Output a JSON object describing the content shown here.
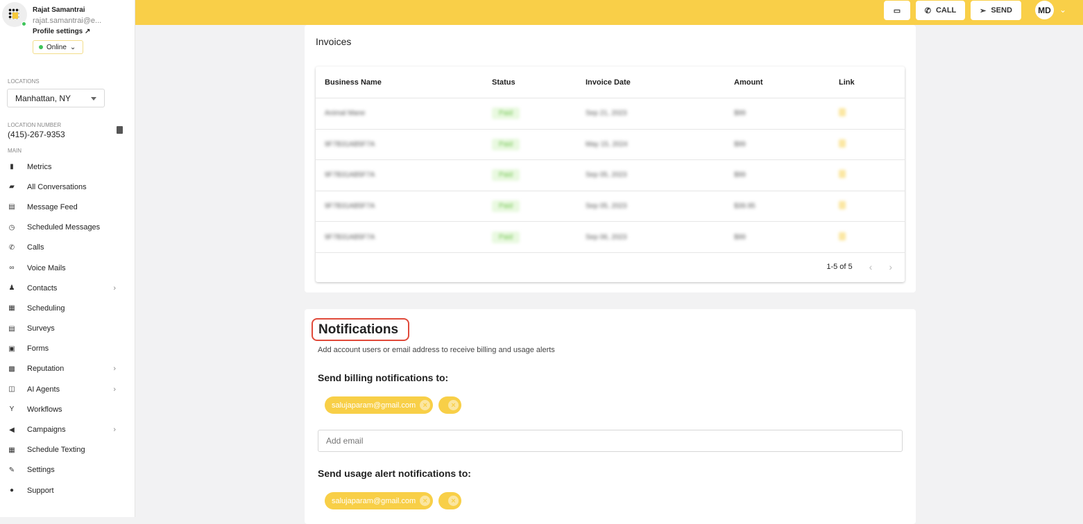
{
  "user": {
    "name": "Rajat Samantrai",
    "email": "rajat.samantrai@e...",
    "profile_settings": "Profile settings",
    "status": "Online"
  },
  "sidebar": {
    "locations_label": "LOCATIONS",
    "location": "Manhattan, NY",
    "location_number_label": "LOCATION NUMBER",
    "location_number": "(415)-267-9353",
    "main_label": "MAIN",
    "items": [
      {
        "label": "Metrics",
        "icon": "▮"
      },
      {
        "label": "All Conversations",
        "icon": "▰"
      },
      {
        "label": "Message Feed",
        "icon": "▤"
      },
      {
        "label": "Scheduled Messages",
        "icon": "◷"
      },
      {
        "label": "Calls",
        "icon": "✆"
      },
      {
        "label": "Voice Mails",
        "icon": "∞"
      },
      {
        "label": "Contacts",
        "icon": "♟",
        "chevron": "›"
      },
      {
        "label": "Scheduling",
        "icon": "▦"
      },
      {
        "label": "Surveys",
        "icon": "▤"
      },
      {
        "label": "Forms",
        "icon": "▣"
      },
      {
        "label": "Reputation",
        "icon": "▩",
        "chevron": "›"
      },
      {
        "label": "AI Agents",
        "icon": "◫",
        "chevron": "›"
      },
      {
        "label": "Workflows",
        "icon": "Y"
      },
      {
        "label": "Campaigns",
        "icon": "◀",
        "chevron": "›"
      },
      {
        "label": "Schedule Texting",
        "icon": "▦"
      },
      {
        "label": "Settings",
        "icon": "✎"
      },
      {
        "label": "Support",
        "icon": "●"
      }
    ]
  },
  "topbar": {
    "call": "CALL",
    "send": "SEND",
    "avatar": "MD"
  },
  "invoices": {
    "title": "Invoices",
    "columns": [
      "Business Name",
      "Status",
      "Invoice Date",
      "Amount",
      "Link"
    ],
    "rows": [
      {
        "name": "Animal Mane",
        "status": "Paid",
        "date": "Sep 21, 2023",
        "amount": "$99"
      },
      {
        "name": "9F7B31AB5F7A",
        "status": "Paid",
        "date": "May 15, 2024",
        "amount": "$99"
      },
      {
        "name": "9F7B31AB5F7A",
        "status": "Paid",
        "date": "Sep 05, 2023",
        "amount": "$99"
      },
      {
        "name": "9F7B31AB5F7A",
        "status": "Paid",
        "date": "Sep 05, 2023",
        "amount": "$39.95"
      },
      {
        "name": "9F7B31AB5F7A",
        "status": "Paid",
        "date": "Sep 06, 2023",
        "amount": "$99"
      }
    ],
    "pagination": "1-5 of 5"
  },
  "notifications": {
    "title": "Notifications",
    "subtitle": "Add account users or email address to receive billing and usage alerts",
    "billing_heading": "Send billing notifications to:",
    "billing_emails": [
      "salujaparam@gmail.com"
    ],
    "add_email_placeholder": "Add email",
    "usage_heading": "Send usage alert notifications to:",
    "usage_emails": [
      "salujaparam@gmail.com"
    ]
  }
}
